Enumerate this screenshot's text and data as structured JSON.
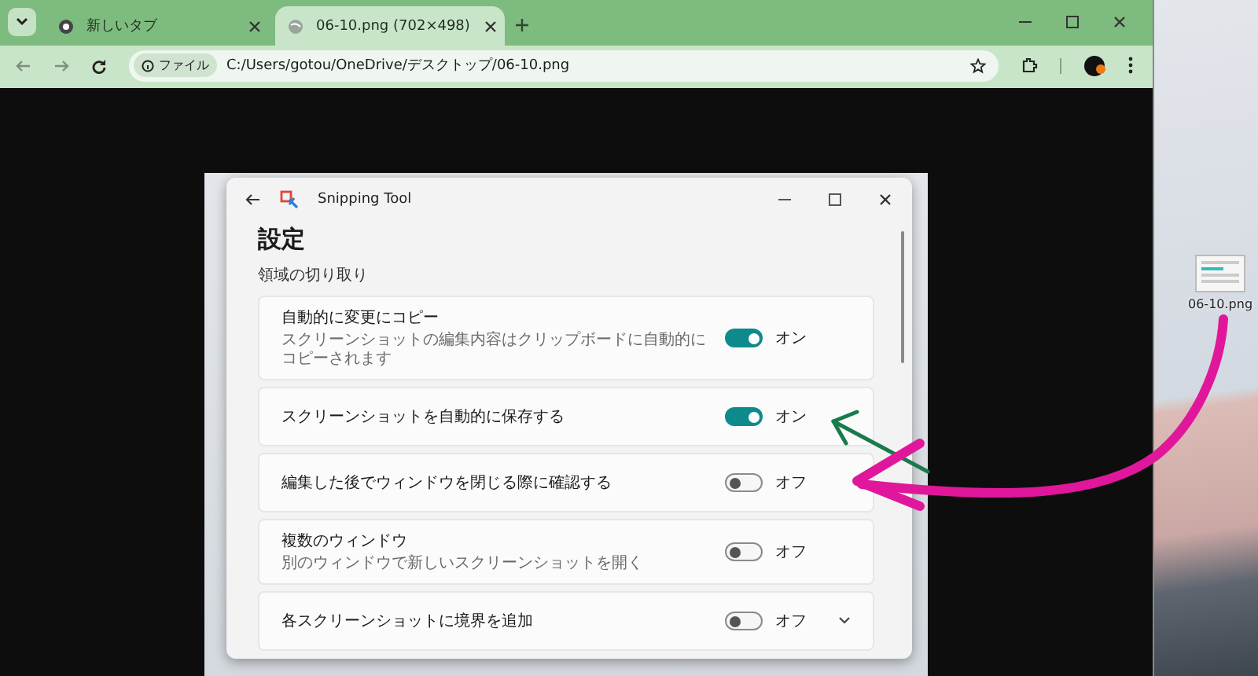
{
  "browser": {
    "tabs": [
      {
        "title": "新しいタブ",
        "selected": false
      },
      {
        "title": "06-10.png (702×498)",
        "selected": true
      }
    ],
    "address": {
      "chip": "ファイル",
      "url": "C:/Users/gotou/OneDrive/デスクトップ/06-10.png"
    }
  },
  "app": {
    "title": "Snipping Tool",
    "heading": "設定",
    "section": "領域の切り取り",
    "settings": [
      {
        "label": "自動的に変更にコピー",
        "description": "スクリーンショットの編集内容はクリップボードに自動的にコピーされます",
        "on": true,
        "state_text": "オン",
        "expandable": false
      },
      {
        "label": "スクリーンショットを自動的に保存する",
        "on": true,
        "state_text": "オン",
        "expandable": false
      },
      {
        "label": "編集した後でウィンドウを閉じる際に確認する",
        "on": false,
        "state_text": "オフ",
        "expandable": false
      },
      {
        "label": "複数のウィンドウ",
        "description": "別のウィンドウで新しいスクリーンショットを開く",
        "on": false,
        "state_text": "オフ",
        "expandable": false
      },
      {
        "label": "各スクリーンショットに境界を追加",
        "on": false,
        "state_text": "オフ",
        "expandable": true
      }
    ]
  },
  "desktop": {
    "icon_label": "06-10.png"
  }
}
